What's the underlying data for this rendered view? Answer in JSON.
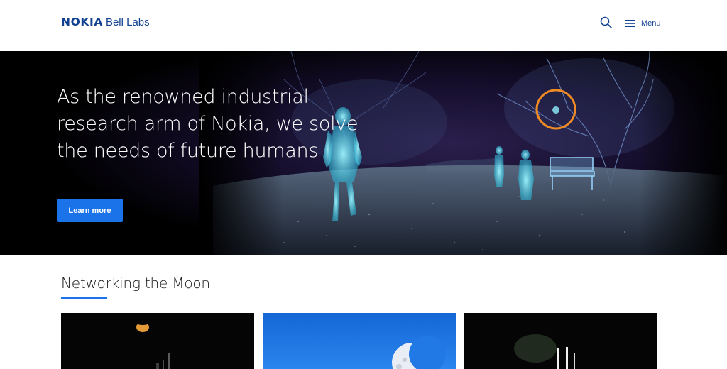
{
  "header": {
    "logo_brand": "NOKIA",
    "logo_product": "Bell Labs",
    "search_icon": "search-icon",
    "menu_icon": "hamburger-menu-icon",
    "menu_label": "Menu"
  },
  "hero": {
    "title": "As the renowned industrial research arm of Nokia, we solve the needs of future humans",
    "cta_label": "Learn more"
  },
  "section": {
    "title": "Networking the Moon"
  },
  "colors": {
    "brand_blue": "#124191",
    "accent_blue": "#1a73e8",
    "hero_bg": "#000000"
  }
}
